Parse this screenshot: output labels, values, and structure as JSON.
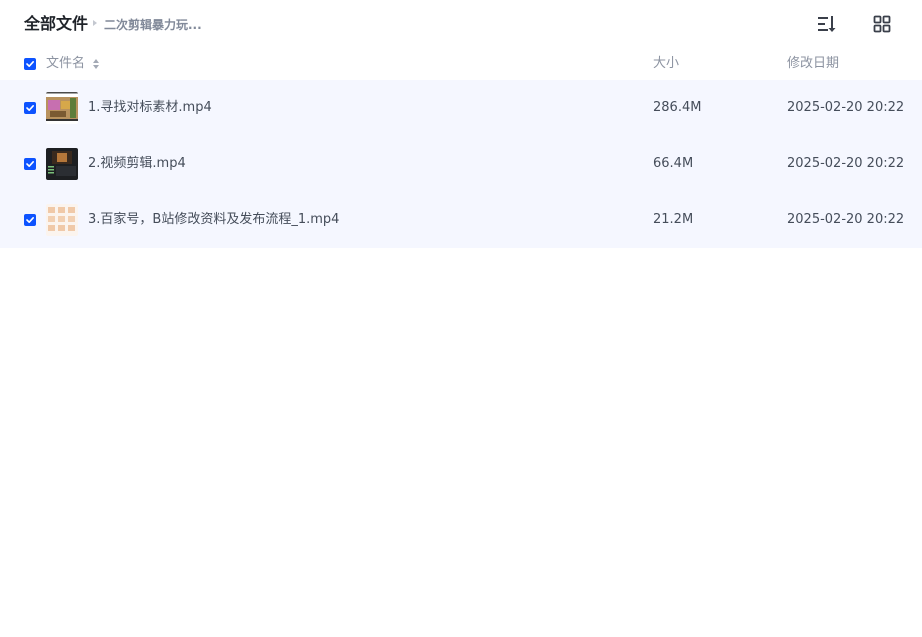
{
  "breadcrumb": {
    "root": "全部文件",
    "current": "二次剪辑暴力玩..."
  },
  "toolbar": {
    "sort_icon": "sort-list-icon",
    "view_icon": "grid-view-icon"
  },
  "columns": {
    "name": "文件名",
    "size": "大小",
    "modified": "修改日期"
  },
  "select_all_checked": true,
  "files": [
    {
      "name": "1.寻找对标素材.mp4",
      "size": "286.4M",
      "modified": "2025-02-20 20:22",
      "checked": true
    },
    {
      "name": "2.视频剪辑.mp4",
      "size": "66.4M",
      "modified": "2025-02-20 20:22",
      "checked": true
    },
    {
      "name": "3.百家号，B站修改资料及发布流程_1.mp4",
      "size": "21.2M",
      "modified": "2025-02-20 20:22",
      "checked": true
    }
  ],
  "colors": {
    "accent": "#0d53ff",
    "row_selected_bg": "#f5f7ff",
    "text_primary": "#454d5a",
    "text_header": "#8c93a1"
  }
}
